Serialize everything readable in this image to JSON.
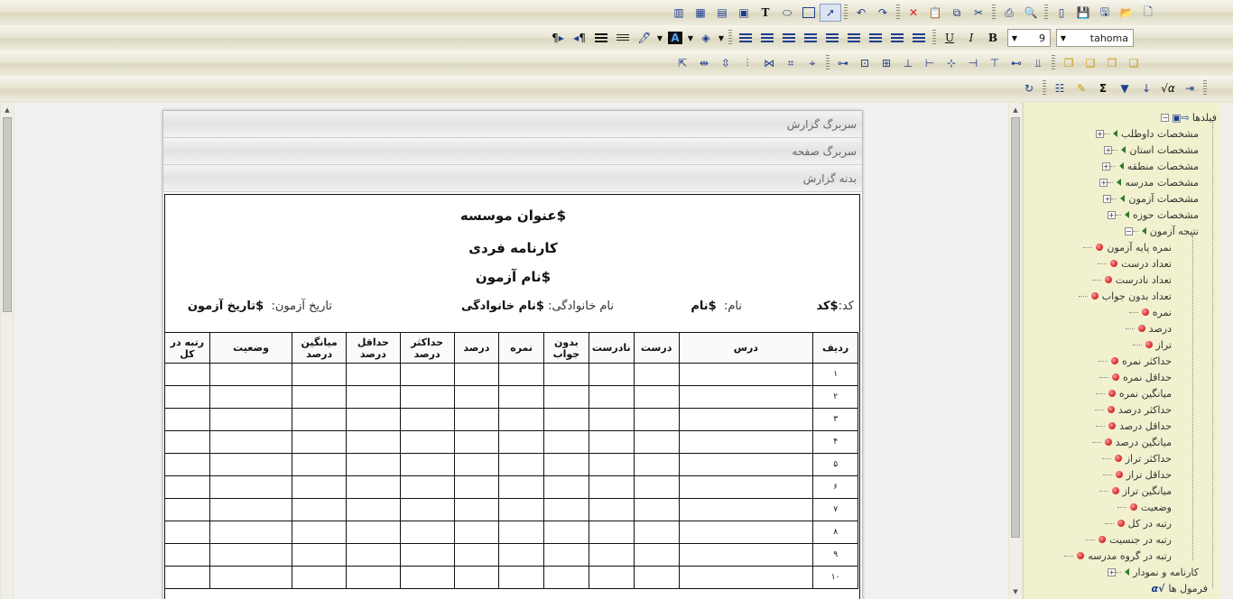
{
  "toolbar": {
    "font_name": "tahoma",
    "font_size": "9",
    "bold_label": "B",
    "italic_label": "I",
    "underline_label": "U",
    "text_tool_label": "T",
    "sum_label": "Σ",
    "para_ltr_label": "¶",
    "para_rtl_label": "¶",
    "sort_label": "↓",
    "sqrt_label": "√α"
  },
  "report": {
    "bands": {
      "report_header": "سربرگ گزارش",
      "page_header": "سربرگ صفحه",
      "report_body": "بدنه گزارش"
    },
    "titles": [
      "$عنوان موسسه",
      "کارنامه فردی",
      "$نام آزمون"
    ],
    "fields": {
      "code_label": "کد:",
      "code_value": "$کد",
      "name_label": "نام:",
      "name_value": "$نام",
      "family_label": "نام خانوادگی:",
      "family_value": "$نام خانوادگی",
      "date_label": "تاریخ آزمون:",
      "date_value": "$تاریخ آزمون"
    },
    "table": {
      "columns": [
        "ردیف",
        "درس",
        "درست",
        "نادرست",
        "بدون جواب",
        "نمره",
        "درصد",
        "حداکثر درصد",
        "حداقل درصد",
        "میانگین درصد",
        "وضعیت",
        "رتبه در کل"
      ],
      "rows": [
        "۱",
        "۲",
        "۳",
        "۴",
        "۵",
        "۶",
        "۷",
        "۸",
        "۹",
        "۱۰"
      ]
    }
  },
  "tree": {
    "root": "فیلدها",
    "groups": [
      "مشخصات داوطلب",
      "مشخصات استان",
      "مشخصات منطقه",
      "مشخصات مدرسه",
      "مشخصات آزمون",
      "مشخصات حوزه"
    ],
    "open_group": "نتیجه آزمون",
    "open_group_items": [
      "نمره پایه آزمون",
      "تعداد درست",
      "تعداد نادرست",
      "تعداد بدون جواب",
      "نمره",
      "درصد",
      "تراز",
      "حداکثر نمره",
      "حداقل نمره",
      "میانگین نمره",
      "حداکثر درصد",
      "حداقل درصد",
      "میانگین درصد",
      "حداکثر تراز",
      "حداقل تراز",
      "میانگین تراز",
      "وضعیت",
      "رتبه در کل",
      "رتبه در جنسیت",
      "رتبه در گروه مدرسه"
    ],
    "after_group": "کارنامه و نمودار",
    "formulas": "فرمول ها"
  },
  "colors": {
    "toolbar_bg": "#ebe9da",
    "panel_bg": "#f1f1cf",
    "icon_blue": "#1e3d8f",
    "delete_red": "#d92020"
  }
}
